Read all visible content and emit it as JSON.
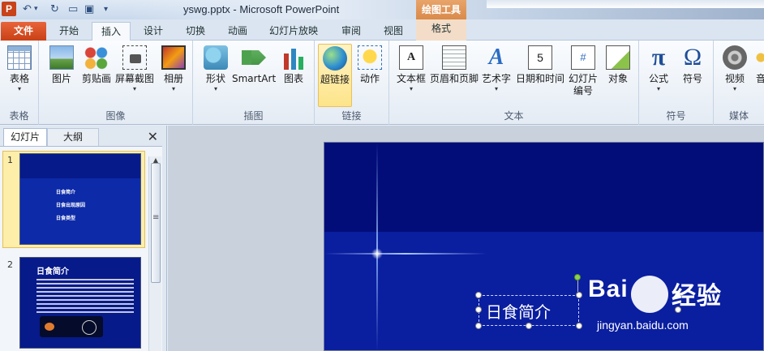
{
  "titlebar": {
    "app_icon": "P",
    "title": "yswg.pptx  -  Microsoft PowerPoint",
    "tools_header": "绘图工具",
    "qat": {
      "undo_icon": "↶",
      "redo_icon": "↻",
      "new_icon": "▭",
      "save_icon": "▣",
      "more_icon": "▾"
    }
  },
  "tabs": [
    {
      "label": "文件"
    },
    {
      "label": "开始"
    },
    {
      "label": "插入"
    },
    {
      "label": "设计"
    },
    {
      "label": "切换"
    },
    {
      "label": "动画"
    },
    {
      "label": "幻灯片放映"
    },
    {
      "label": "审阅"
    },
    {
      "label": "视图"
    },
    {
      "label": "格式"
    }
  ],
  "ribbon": {
    "groups": {
      "tables": "表格",
      "images": "图像",
      "illustrations": "插图",
      "links": "链接",
      "text": "文本",
      "symbols": "符号",
      "media": "媒体"
    },
    "buttons": {
      "table": "表格",
      "picture": "图片",
      "clipart": "剪贴画",
      "screenshot": "屏幕截图",
      "album": "相册",
      "shapes": "形状",
      "smartart": "SmartArt",
      "chart": "图表",
      "hyperlink": "超链接",
      "action": "动作",
      "textbox": "文本框",
      "header_footer": "页眉和页脚",
      "wordart": "艺术字",
      "datetime": "日期和时间",
      "slide_number_1": "幻灯片",
      "slide_number_2": "编号",
      "object": "对象",
      "formula": "公式",
      "symbol": "符号",
      "video": "视频",
      "audio": "音"
    },
    "icon_glyphs": {
      "textbox": "A",
      "wordart": "A",
      "datetime": "5",
      "slide_number": "#",
      "formula": "π",
      "symbol": "Ω",
      "dropdown": "▾"
    }
  },
  "leftpanel": {
    "tab_slides": "幻灯片",
    "tab_outline": "大纲",
    "close_icon": "✕",
    "scroll_up": "▲",
    "scroll_grip": "≡",
    "slides": [
      {
        "number": "1",
        "lines": [
          "日食简介",
          "日食出现原因",
          "日食类型"
        ]
      },
      {
        "number": "2",
        "title": "日食简介"
      }
    ]
  },
  "slide": {
    "title": "日食简介"
  },
  "watermark": {
    "brand": "Bai",
    "brand2": "经验",
    "url": "jingyan.baidu.com"
  }
}
